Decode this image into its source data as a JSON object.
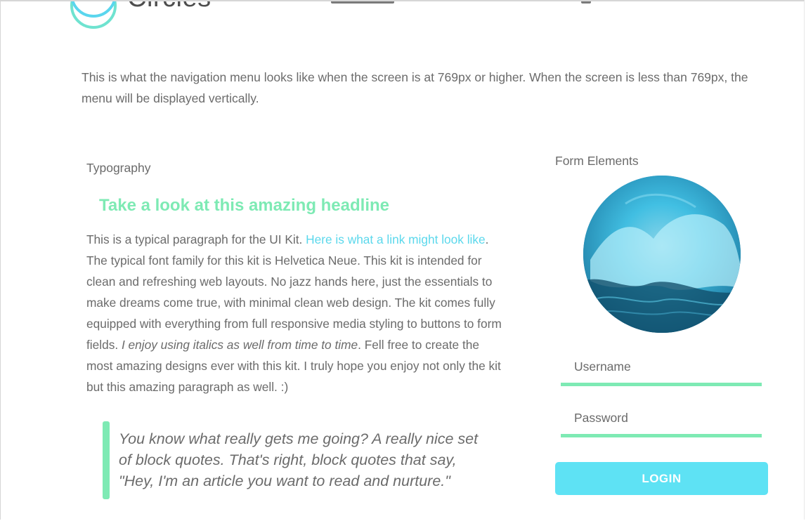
{
  "header": {
    "logo_text": "Circles",
    "logo_icon": "circles-logo-icon"
  },
  "intro": {
    "text": "This is what the navigation menu looks like when the screen is at 769px or higher. When the screen is less than 769px, the menu will be displayed vertically."
  },
  "typography": {
    "label": "Typography",
    "headline": "Take a look at this amazing headline",
    "paragraph_start": "This is a typical paragraph for the UI Kit. ",
    "link_text": "Here is what a link might look like",
    "paragraph_middle": ". The typical font family for this kit is Helvetica Neue. This kit is intended for clean and refreshing web layouts. No jazz hands here, just the essentials to make dreams come true, with minimal clean web design. The kit comes fully equipped with everything from full responsive media styling to buttons to form fields. ",
    "italic_text": "I enjoy using italics as well from time to time",
    "paragraph_end": ". Fell free to create the most amazing designs ever with this kit. I truly hope you enjoy not only the kit but this amazing paragraph as well. :)",
    "blockquote": "You know what really gets me going? A really nice set of block quotes. That's right, block quotes that say, \"Hey, I'm an article you want to read and nurture.\""
  },
  "form": {
    "label": "Form Elements",
    "username_placeholder": "Username",
    "password_placeholder": "Password",
    "login_label": "LOGIN"
  },
  "colors": {
    "accent_green": "#7eeab4",
    "accent_cyan": "#5ee2f4",
    "link": "#5bd8ec",
    "text": "#6b6b6b"
  }
}
